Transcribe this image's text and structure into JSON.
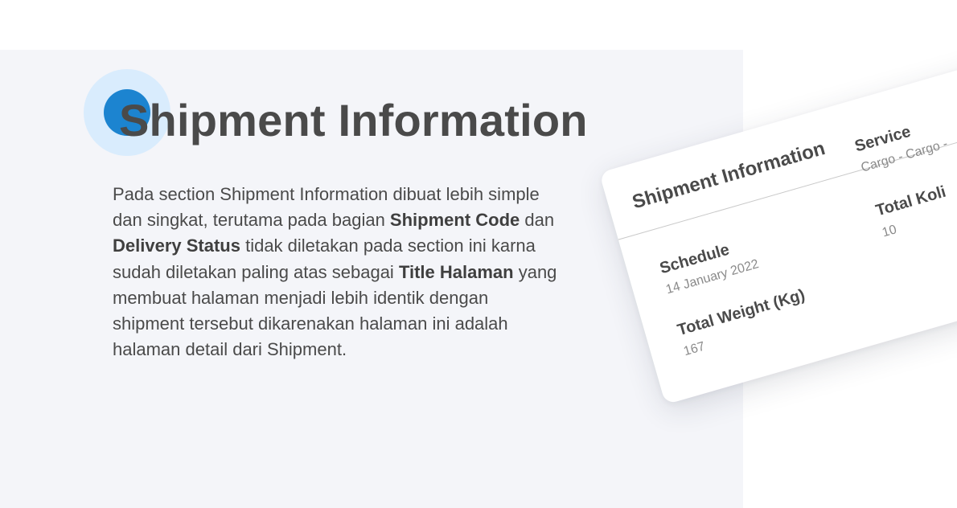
{
  "section": {
    "heading": "Shipment Information",
    "description": {
      "p1": "Pada section Shipment Information dibuat lebih simple dan singkat, terutama pada bagian ",
      "shipment_code": "Shipment Code",
      "p2": " dan ",
      "delivery_status": "Delivery Status",
      "p3": " tidak diletakan pada section ini karna sudah diletakan paling atas sebagai ",
      "title_halaman": "Title Halaman",
      "p4": " yang membuat halaman menjadi lebih identik dengan shipment tersebut dikarenakan halaman ini adalah halaman detail dari Shipment."
    },
    "accent_color": "#1c84d0",
    "accent_light_color": "#d9ecfd",
    "panel_color": "#f4f5f9"
  },
  "card": {
    "title": "Shipment Information",
    "service": {
      "label": "Service",
      "value": "Cargo - Cargo -"
    },
    "schedule": {
      "label": "Schedule",
      "value": "14 January 2022"
    },
    "total_koli": {
      "label": "Total Koli",
      "value": "10"
    },
    "total_weight": {
      "label": "Total Weight (Kg)",
      "value": "167"
    }
  }
}
